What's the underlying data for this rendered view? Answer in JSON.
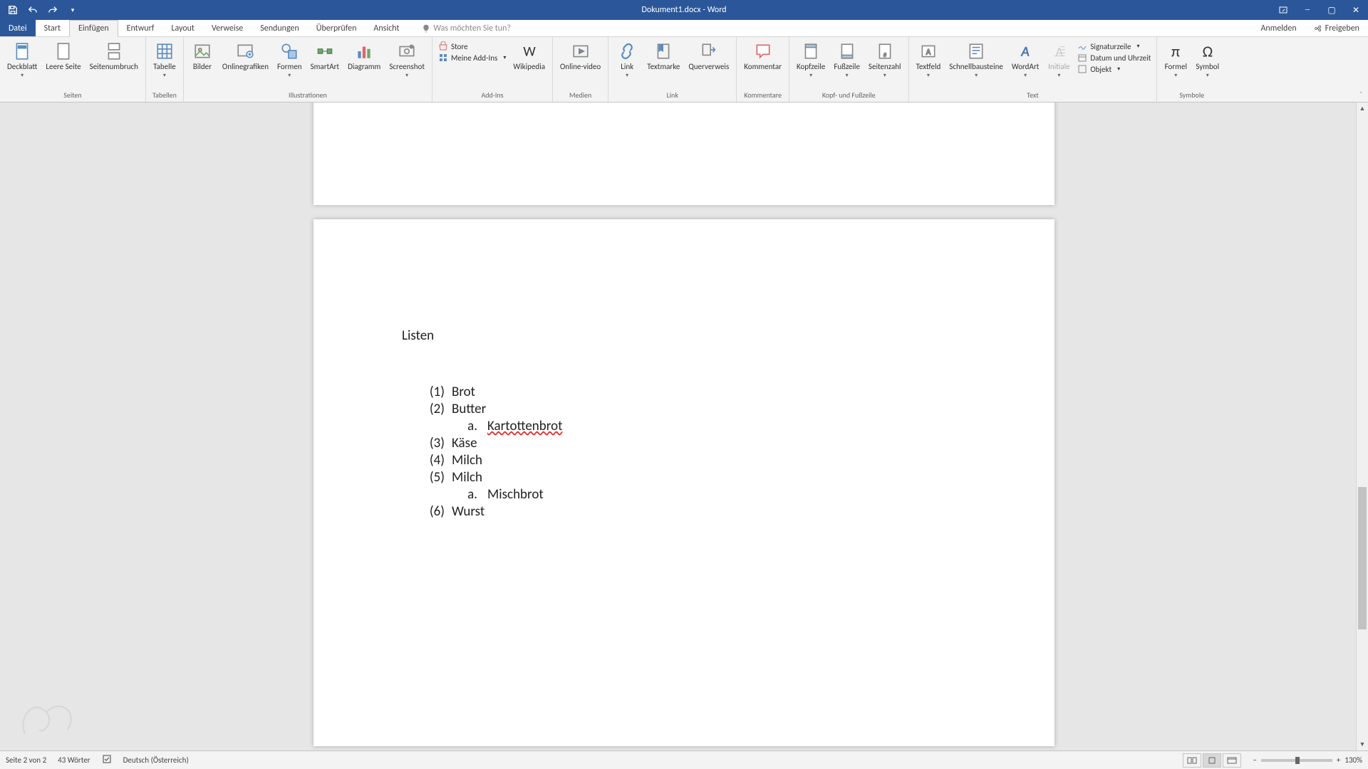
{
  "title": "Dokument1.docx - Word",
  "tabs": {
    "file": "Datei",
    "start": "Start",
    "einfuegen": "Einfügen",
    "entwurf": "Entwurf",
    "layout": "Layout",
    "verweise": "Verweise",
    "sendungen": "Sendungen",
    "ueberpruefen": "Überprüfen",
    "ansicht": "Ansicht"
  },
  "tellme_placeholder": "Was möchten Sie tun?",
  "account": "Anmelden",
  "share": "Freigeben",
  "ribbon": {
    "seiten": {
      "deckblatt": "Deckblatt",
      "leere": "Leere Seite",
      "umbruch": "Seitenumbruch",
      "label": "Seiten"
    },
    "tabellen": {
      "tabelle": "Tabelle",
      "label": "Tabellen"
    },
    "illus": {
      "bilder": "Bilder",
      "online": "Onlinegrafiken",
      "formen": "Formen",
      "smartart": "SmartArt",
      "diagramm": "Diagramm",
      "screenshot": "Screenshot",
      "label": "Illustrationen"
    },
    "addins": {
      "store": "Store",
      "meine": "Meine Add-Ins",
      "wikipedia": "Wikipedia",
      "label": "Add-Ins"
    },
    "medien": {
      "video": "Online-video",
      "label": "Medien"
    },
    "link": {
      "link": "Link",
      "textmarke": "Textmarke",
      "querverweis": "Querverweis",
      "label": "Link"
    },
    "kommentare": {
      "kommentar": "Kommentar",
      "label": "Kommentare"
    },
    "kopf": {
      "kopfzeile": "Kopfzeile",
      "fusszeile": "Fußzeile",
      "seitenzahl": "Seitenzahl",
      "label": "Kopf- und Fußzeile"
    },
    "text": {
      "textfeld": "Textfeld",
      "schnell": "Schnellbausteine",
      "wordart": "WordArt",
      "initiale": "Initiale",
      "signatur": "Signaturzeile",
      "datum": "Datum und Uhrzeit",
      "objekt": "Objekt",
      "label": "Text"
    },
    "symbole": {
      "formel": "Formel",
      "symbol": "Symbol",
      "label": "Symbole"
    }
  },
  "document": {
    "heading": "Listen",
    "items": [
      {
        "n": "(1)",
        "t": "Brot"
      },
      {
        "n": "(2)",
        "t": "Butter"
      },
      {
        "sub": true,
        "l": "a.",
        "t": "Kartottenbrot",
        "spell": true
      },
      {
        "n": "(3)",
        "t": "Käse"
      },
      {
        "n": "(4)",
        "t": "Milch"
      },
      {
        "n": "(5)",
        "t": "Milch"
      },
      {
        "sub": true,
        "l": "a.",
        "t": "Mischbrot"
      },
      {
        "n": "(6)",
        "t": "Wurst"
      }
    ]
  },
  "status": {
    "page": "Seite 2 von 2",
    "words": "43 Wörter",
    "lang": "Deutsch (Österreich)",
    "zoom": "130%"
  }
}
